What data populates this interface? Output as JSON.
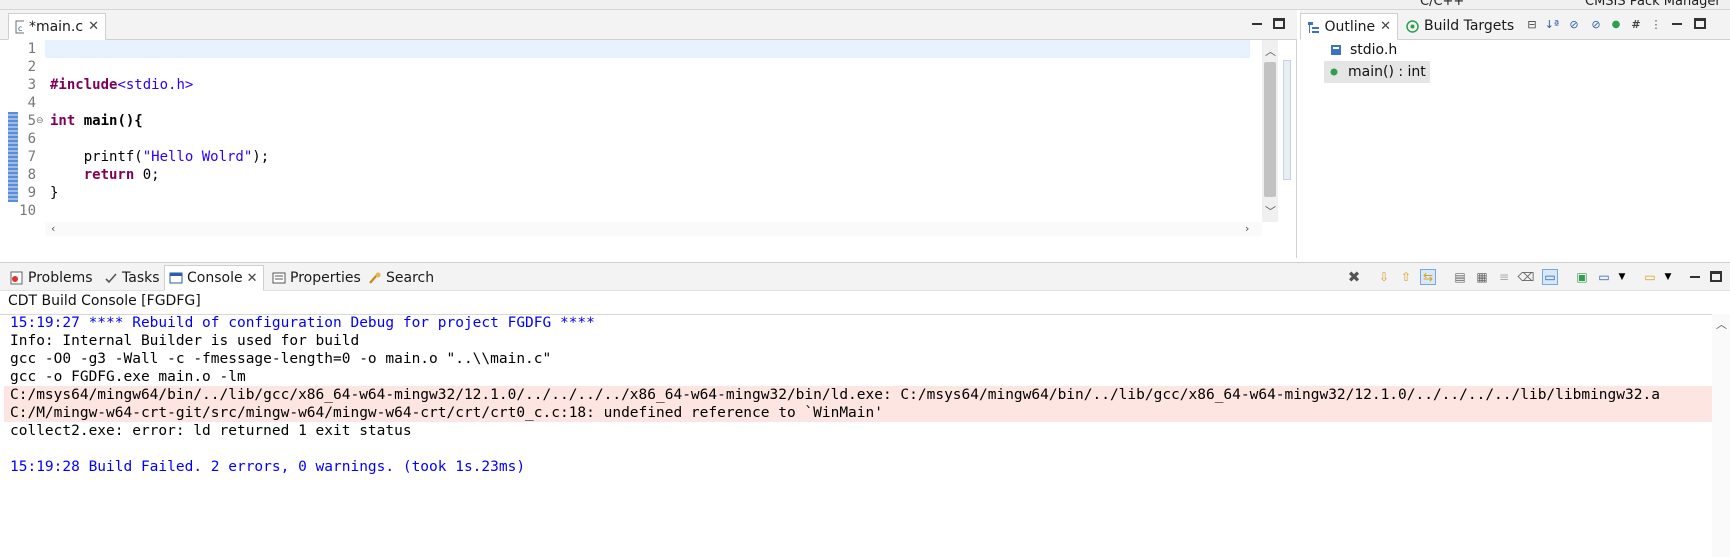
{
  "top_strip": {
    "perspective_label": "C/C++",
    "other_label": "CMSIS Pack Manager"
  },
  "editor": {
    "tab_label": "*main.c",
    "lines": [
      {
        "num": "1",
        "text": ""
      },
      {
        "num": "2",
        "text": ""
      },
      {
        "num": "3",
        "text": "#include<stdio.h>"
      },
      {
        "num": "4",
        "text": ""
      },
      {
        "num": "5",
        "text": "int main(){"
      },
      {
        "num": "6",
        "text": ""
      },
      {
        "num": "7",
        "text": "    printf(\"Hello Wolrd\");"
      },
      {
        "num": "8",
        "text": "    return 0;"
      },
      {
        "num": "9",
        "text": "}"
      },
      {
        "num": "10",
        "text": ""
      }
    ],
    "tokens": {
      "include_kw": "#include",
      "include_file": "<stdio.h>",
      "int_kw": "int",
      "main_sig": " main(){",
      "printf_pre": "    printf(",
      "printf_str": "\"Hello Wolrd\"",
      "printf_post": ");",
      "return_pre": "    ",
      "return_kw": "return",
      "return_post": " 0;",
      "close_brace": "}"
    }
  },
  "outline": {
    "tabs": [
      {
        "label": "Outline"
      },
      {
        "label": "Build Targets"
      }
    ],
    "items": [
      {
        "label": "stdio.h",
        "icon": "include-icon"
      },
      {
        "label": "main() : int",
        "icon": "function-icon",
        "selected": true
      }
    ]
  },
  "console": {
    "tabs": [
      {
        "label": "Problems"
      },
      {
        "label": "Tasks"
      },
      {
        "label": "Console",
        "active": true
      },
      {
        "label": "Properties"
      },
      {
        "label": "Search"
      }
    ],
    "title": "CDT Build Console [FGDFG]",
    "lines": [
      {
        "text": "15:19:27 **** Rebuild of configuration Debug for project FGDFG ****",
        "style": "blue"
      },
      {
        "text": "Info: Internal Builder is used for build",
        "style": "normal"
      },
      {
        "text": "gcc -O0 -g3 -Wall -c -fmessage-length=0 -o main.o \"..\\\\main.c\"",
        "style": "normal"
      },
      {
        "text": "gcc -o FGDFG.exe main.o -lm",
        "style": "normal"
      },
      {
        "text": "C:/msys64/mingw64/bin/../lib/gcc/x86_64-w64-mingw32/12.1.0/../../../../x86_64-w64-mingw32/bin/ld.exe: C:/msys64/mingw64/bin/../lib/gcc/x86_64-w64-mingw32/12.1.0/../../../../lib/libmingw32.a",
        "style": "error"
      },
      {
        "text": "C:/M/mingw-w64-crt-git/src/mingw-w64/mingw-w64-crt/crt/crt0_c.c:18: undefined reference to `WinMain'",
        "style": "error"
      },
      {
        "text": "collect2.exe: error: ld returned 1 exit status",
        "style": "normal"
      },
      {
        "text": "",
        "style": "normal"
      },
      {
        "text": "15:19:28 Build Failed. 2 errors, 0 warnings. (took 1s.23ms)",
        "style": "blue"
      }
    ]
  },
  "colors": {
    "keyword": "#7f0055",
    "string": "#2a00ff",
    "console_blue": "#0000ff",
    "error_bg": "#fde5e1",
    "current_line": "#e8f2fe"
  }
}
